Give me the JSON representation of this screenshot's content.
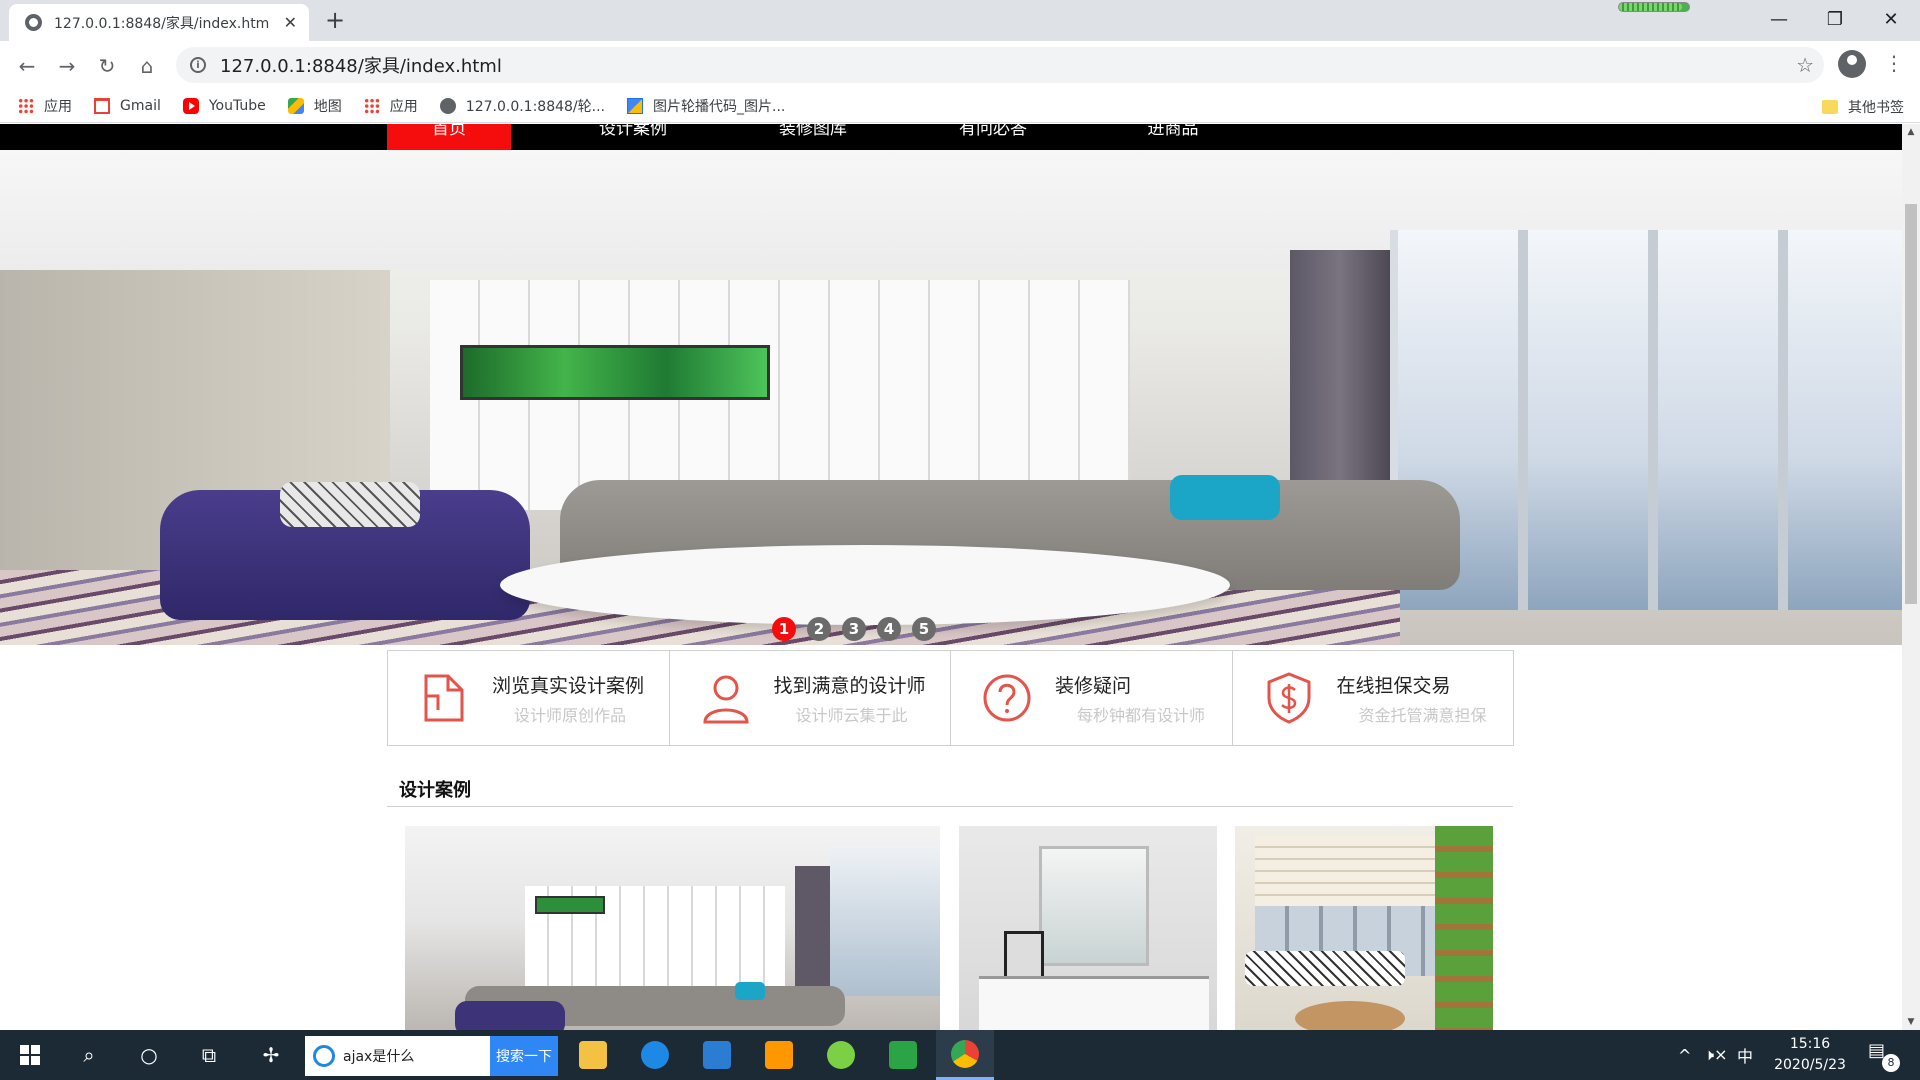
{
  "browser": {
    "tab_title": "127.0.0.1:8848/家具/index.htm",
    "tab_close": "✕",
    "new_tab": "+",
    "url": "127.0.0.1:8848/家具/index.html",
    "window_controls": {
      "minimize": "—",
      "restore": "❐",
      "close": "✕"
    },
    "loading_progress": 0.9
  },
  "bookmarks": [
    {
      "label": "应用",
      "icon": "apps-grid-icon"
    },
    {
      "label": "Gmail",
      "icon": "gmail-icon"
    },
    {
      "label": "YouTube",
      "icon": "youtube-icon"
    },
    {
      "label": "地图",
      "icon": "maps-icon"
    },
    {
      "label": "应用",
      "icon": "apps-grid-icon"
    },
    {
      "label": "127.0.0.1:8848/轮...",
      "icon": "globe-icon"
    },
    {
      "label": "图片轮播代码_图片...",
      "icon": "image-icon"
    }
  ],
  "bookmarks_other": "其他书签",
  "site": {
    "nav": [
      "首页",
      "设计案例",
      "装修图库",
      "有问必答",
      "进商品"
    ],
    "active_nav": 0,
    "carousel": {
      "dots": [
        "1",
        "2",
        "3",
        "4",
        "5"
      ],
      "active": 0
    },
    "features": [
      {
        "title": "浏览真实设计案例",
        "subtitle": "设计师原创作品",
        "icon": "document-icon"
      },
      {
        "title": "找到满意的设计师",
        "subtitle": "设计师云集于此",
        "icon": "designer-icon"
      },
      {
        "title": "装修疑问",
        "subtitle": "每秒钟都有设计师",
        "icon": "question-icon"
      },
      {
        "title": "在线担保交易",
        "subtitle": "资金托管满意担保",
        "icon": "shield-dollar-icon"
      }
    ],
    "section_title": "设计案例",
    "accent_color": "#f50d0d"
  },
  "taskbar": {
    "search_value": "ajax是什么",
    "search_button": "搜索一下",
    "tray_ime": "中",
    "tray_volume": "🕨×",
    "tray_chevron": "^",
    "time": "15:16",
    "date": "2020/5/23",
    "notification_count": "8"
  }
}
